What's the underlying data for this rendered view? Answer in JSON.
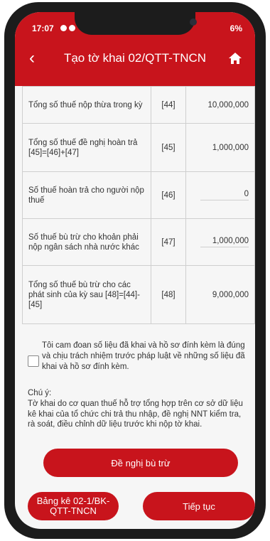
{
  "status": {
    "time": "17:07",
    "battery": "6%"
  },
  "header": {
    "title": "Tạo tờ khai 02/QTT-TNCN"
  },
  "table": [
    {
      "label": "Tổng số thuế nộp thừa trong kỳ",
      "code": "[44]",
      "value": "10,000,000"
    },
    {
      "label": "Tổng số thuế đề nghị hoàn trả [45]=[46]+[47]",
      "code": "[45]",
      "value": "1,000,000"
    },
    {
      "label": "Số thuế hoàn trả cho người nộp thuế",
      "code": "[46]",
      "value": "0"
    },
    {
      "label": "Số thuế bù trừ cho khoản phải nộp ngân sách nhà nước khác",
      "code": "[47]",
      "value": "1,000,000"
    },
    {
      "label": "Tổng số thuế bù trừ cho các phát sinh của kỳ sau [48]=[44]-[45]",
      "code": "[48]",
      "value": "9,000,000"
    }
  ],
  "declaration": "Tôi cam đoan số liệu đã khai và hồ sơ đính kèm là đúng và chịu trách nhiệm trước pháp luật về những số liệu đã khai và hồ sơ đính kèm.",
  "note": {
    "title": "Chú ý:",
    "body": "Tờ khai do cơ quan thuế hỗ trợ tổng hợp trên cơ sở dữ liệu kê khai của tổ chức chi trả thu nhập, đề nghị NNT kiểm tra, rà soát, điều chỉnh dữ liệu trước khi nộp tờ khai."
  },
  "buttons": {
    "offset": "Đề nghị bù trừ",
    "schedule": "Bảng kê 02-1/BK-QTT-TNCN",
    "continue": "Tiếp tục"
  }
}
